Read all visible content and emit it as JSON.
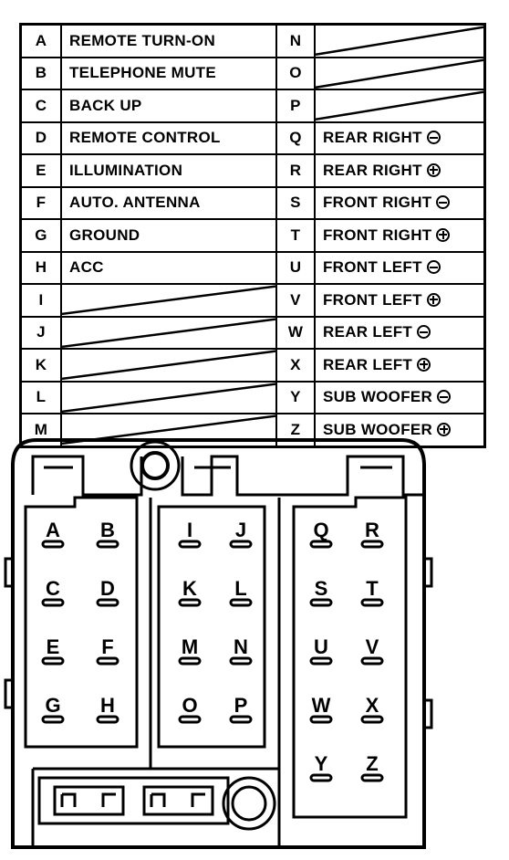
{
  "table": {
    "left_rows": [
      {
        "pin": "A",
        "function": "REMOTE TURN-ON"
      },
      {
        "pin": "B",
        "function": "TELEPHONE MUTE"
      },
      {
        "pin": "C",
        "function": "BACK UP"
      },
      {
        "pin": "D",
        "function": "REMOTE CONTROL"
      },
      {
        "pin": "E",
        "function": "ILLUMINATION"
      },
      {
        "pin": "F",
        "function": "AUTO. ANTENNA"
      },
      {
        "pin": "G",
        "function": "GROUND"
      },
      {
        "pin": "H",
        "function": "ACC"
      },
      {
        "pin": "I",
        "function": ""
      },
      {
        "pin": "J",
        "function": ""
      },
      {
        "pin": "K",
        "function": ""
      },
      {
        "pin": "L",
        "function": ""
      },
      {
        "pin": "M",
        "function": ""
      }
    ],
    "right_rows": [
      {
        "pin": "N",
        "function": "",
        "polarity": ""
      },
      {
        "pin": "O",
        "function": "",
        "polarity": ""
      },
      {
        "pin": "P",
        "function": "",
        "polarity": ""
      },
      {
        "pin": "Q",
        "function": "REAR RIGHT",
        "polarity": "minus"
      },
      {
        "pin": "R",
        "function": "REAR RIGHT",
        "polarity": "plus"
      },
      {
        "pin": "S",
        "function": "FRONT RIGHT",
        "polarity": "minus"
      },
      {
        "pin": "T",
        "function": "FRONT RIGHT",
        "polarity": "plus"
      },
      {
        "pin": "U",
        "function": "FRONT LEFT",
        "polarity": "minus"
      },
      {
        "pin": "V",
        "function": "FRONT LEFT",
        "polarity": "plus"
      },
      {
        "pin": "W",
        "function": "REAR LEFT",
        "polarity": "minus"
      },
      {
        "pin": "X",
        "function": "REAR LEFT",
        "polarity": "plus"
      },
      {
        "pin": "Y",
        "function": "SUB WOOFER",
        "polarity": "minus"
      },
      {
        "pin": "Z",
        "function": "SUB WOOFER",
        "polarity": "plus"
      }
    ]
  },
  "connector": {
    "blocks": [
      {
        "name": "left-block",
        "pins": [
          [
            "A",
            "B"
          ],
          [
            "C",
            "D"
          ],
          [
            "E",
            "F"
          ],
          [
            "G",
            "H"
          ]
        ]
      },
      {
        "name": "middle-block",
        "pins": [
          [
            "I",
            "J"
          ],
          [
            "K",
            "L"
          ],
          [
            "M",
            "N"
          ],
          [
            "O",
            "P"
          ]
        ]
      },
      {
        "name": "right-block",
        "pins": [
          [
            "Q",
            "R"
          ],
          [
            "S",
            "T"
          ],
          [
            "U",
            "V"
          ],
          [
            "W",
            "X"
          ],
          [
            "Y",
            "Z"
          ]
        ]
      }
    ]
  }
}
